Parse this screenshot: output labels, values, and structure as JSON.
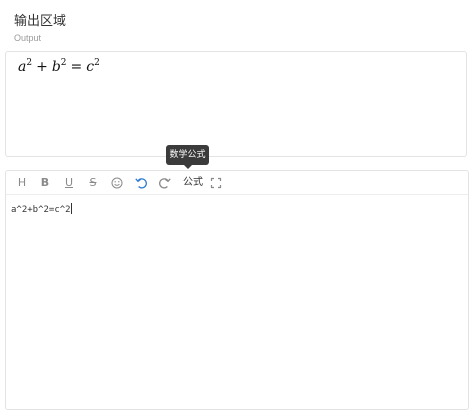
{
  "header": {
    "title": "输出区域",
    "subtitle": "Output"
  },
  "output": {
    "formula": {
      "a": "a",
      "a_exp": "2",
      "plus": "+",
      "b": "b",
      "b_exp": "2",
      "equals": "=",
      "c": "c",
      "c_exp": "2"
    }
  },
  "toolbar": {
    "items": [
      {
        "name": "heading-icon",
        "glyph": "H"
      },
      {
        "name": "bold-icon",
        "glyph": "B"
      },
      {
        "name": "underline-icon",
        "glyph": "U"
      },
      {
        "name": "strikethrough-icon",
        "glyph": "S"
      },
      {
        "name": "emoji-icon"
      },
      {
        "name": "undo-icon",
        "active": true
      },
      {
        "name": "redo-icon"
      },
      {
        "name": "formula-button",
        "label": "公式"
      },
      {
        "name": "fullscreen-icon"
      }
    ],
    "tooltip": "数学公式"
  },
  "editor": {
    "content": "a^2+b^2=c^2"
  },
  "colors": {
    "accent": "#2f7dd4",
    "icon": "#8a8a8a",
    "tooltip_bg": "#3b3b3b",
    "border": "#e3e3e3"
  }
}
